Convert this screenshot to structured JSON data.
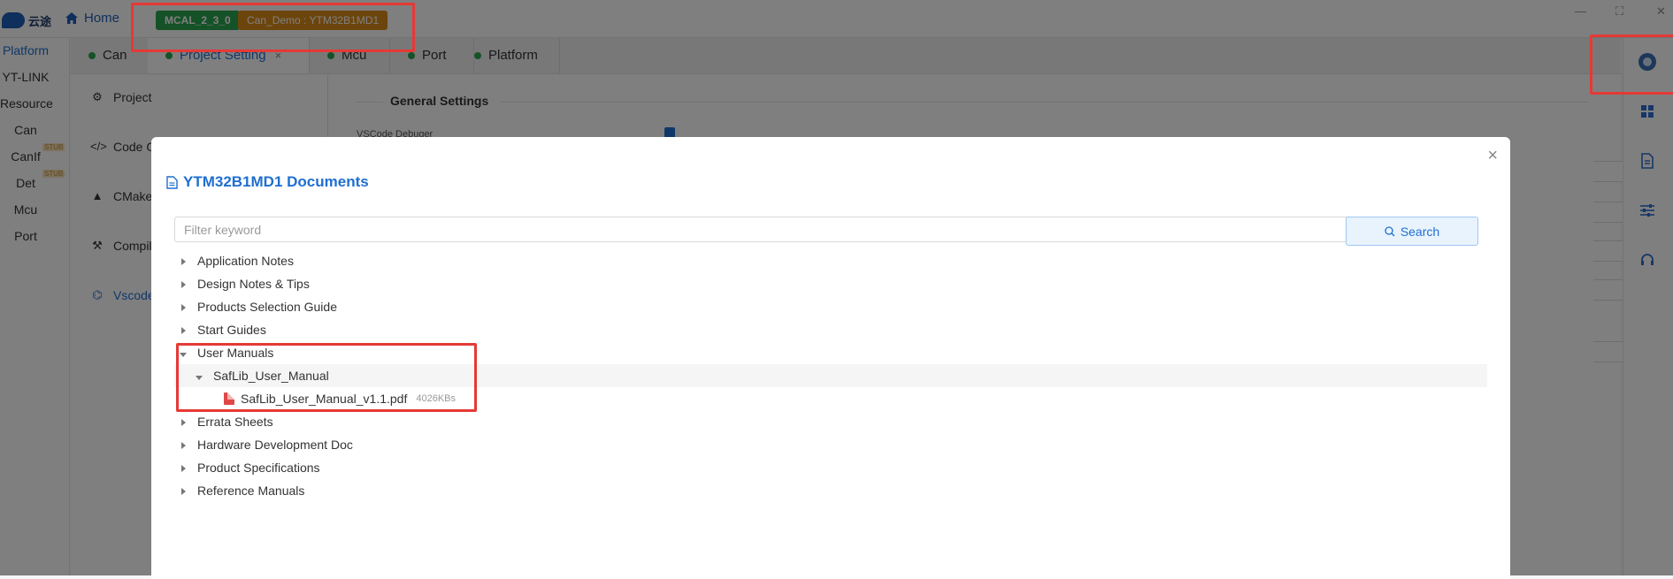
{
  "topbar": {
    "logo_text": "云途",
    "home_label": "Home",
    "badge_mcal": "MCAL_2_3_0",
    "badge_demo": "Can_Demo : YTM32B1MD1"
  },
  "leftnav": {
    "items": [
      {
        "label": "Platform"
      },
      {
        "label": "YT-LINK"
      },
      {
        "label": "Resource"
      },
      {
        "label": "Can"
      },
      {
        "label": "CanIf",
        "stub": "STUB"
      },
      {
        "label": "Det",
        "stub": "STUB"
      },
      {
        "label": "Mcu"
      },
      {
        "label": "Port"
      }
    ]
  },
  "tabs": [
    {
      "label": "Can"
    },
    {
      "label": "Project Setting",
      "close": "×"
    },
    {
      "label": "Mcu"
    },
    {
      "label": "Port"
    },
    {
      "label": "Platform"
    }
  ],
  "side": {
    "items": [
      {
        "label": "Project"
      },
      {
        "label": "Code G"
      },
      {
        "label": "CMake"
      },
      {
        "label": "Compil"
      },
      {
        "label": "Vscode"
      }
    ]
  },
  "content": {
    "general_settings": "General Settings",
    "vscode_debugger": "VSCode Debuger"
  },
  "modal": {
    "title": "YTM32B1MD1 Documents",
    "close": "×",
    "filter_placeholder": "Filter keyword",
    "search_label": "Search",
    "tree": [
      {
        "label": "Application Notes"
      },
      {
        "label": "Design Notes & Tips"
      },
      {
        "label": "Products Selection Guide"
      },
      {
        "label": "Start Guides"
      },
      {
        "label": "User Manuals"
      },
      {
        "label": "SafLib_User_Manual"
      },
      {
        "label": "SafLib_User_Manual_v1.1.pdf",
        "size": "4026KBs"
      },
      {
        "label": "Errata Sheets"
      },
      {
        "label": "Hardware Development Doc"
      },
      {
        "label": "Product Specifications"
      },
      {
        "label": "Reference Manuals"
      }
    ]
  },
  "colors": {
    "accent": "#1f6fd1",
    "badge_green": "#2aa44f",
    "badge_orange": "#d88a1b",
    "highlight_red": "#e53935"
  }
}
